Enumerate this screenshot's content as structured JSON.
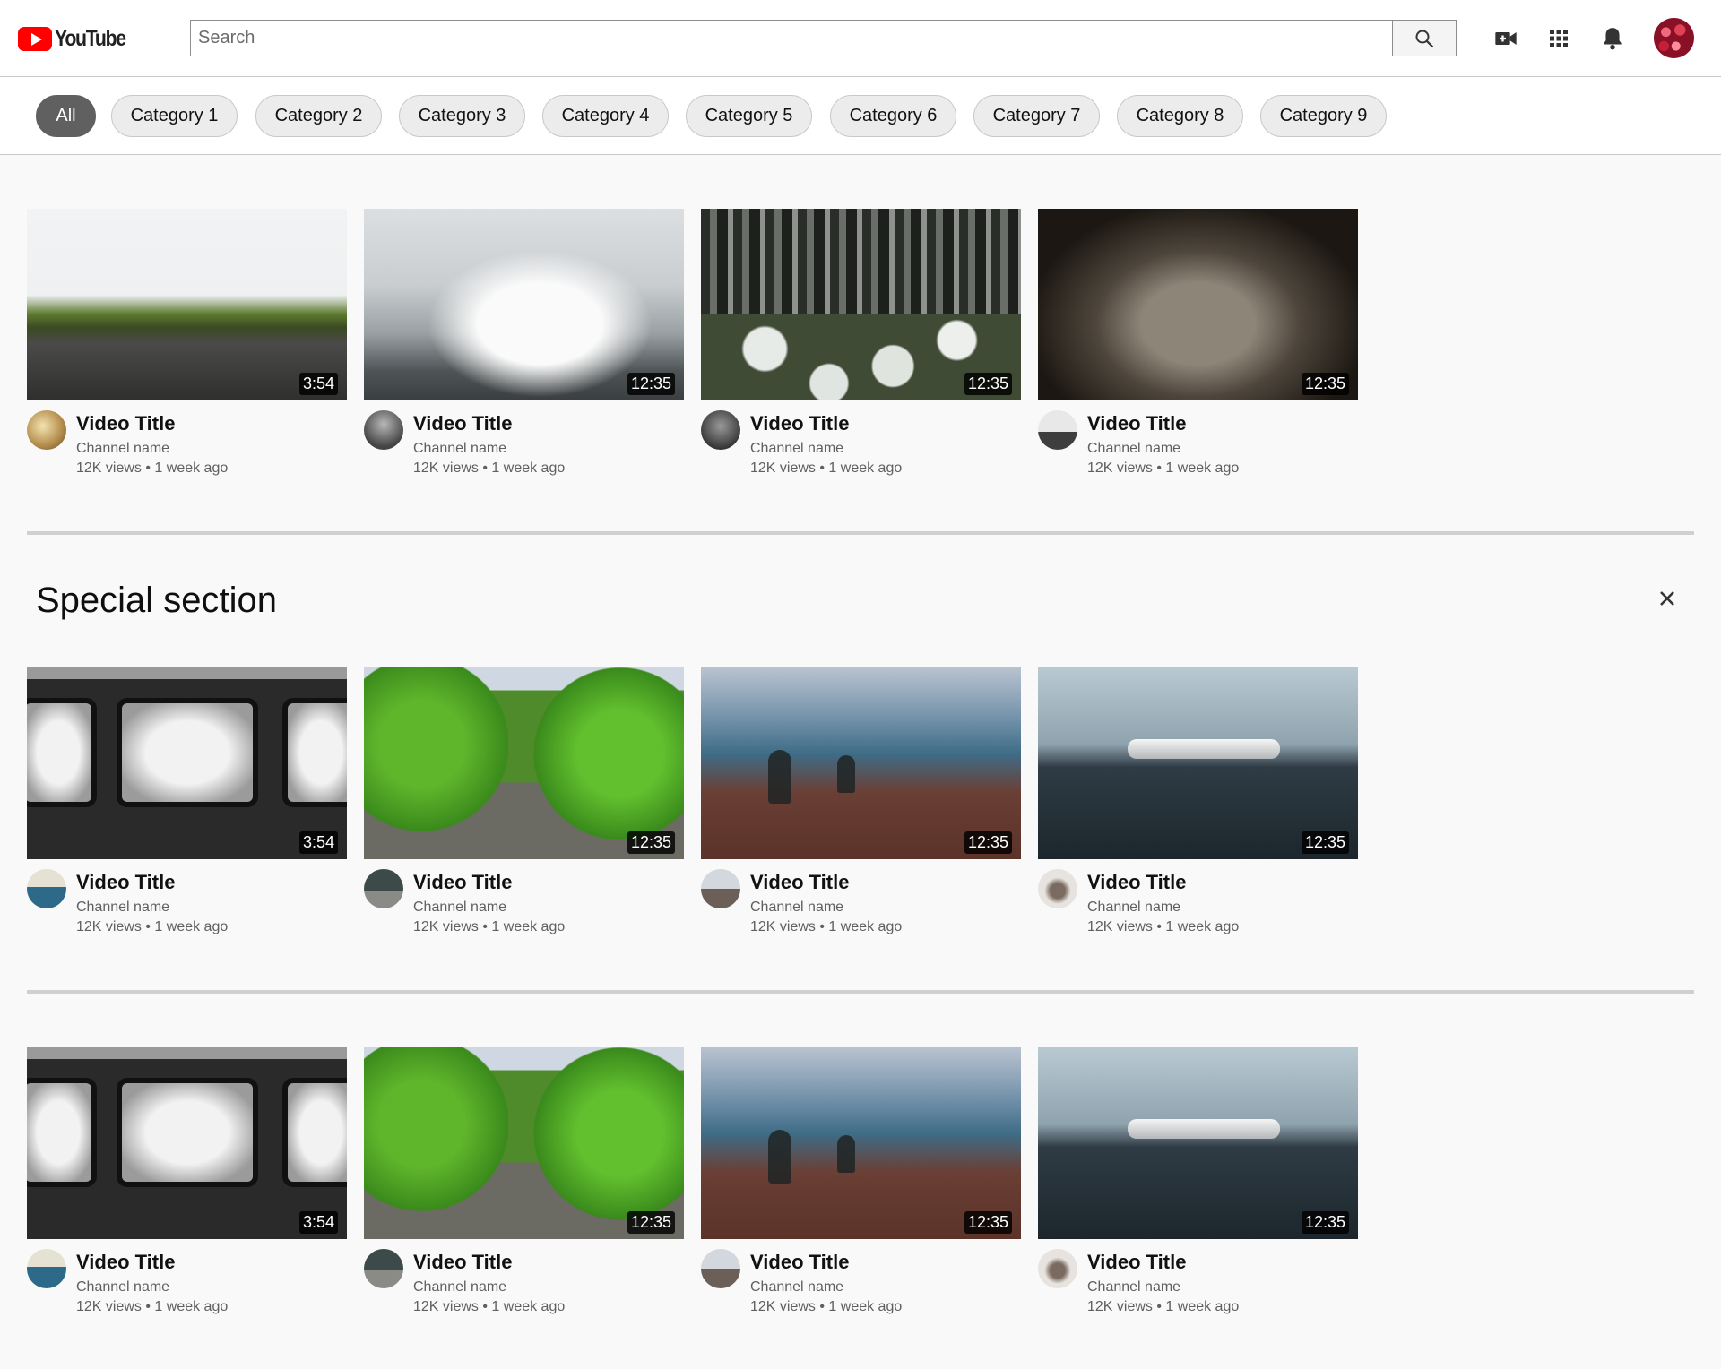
{
  "header": {
    "logo_text": "YouTube",
    "search_placeholder": "Search",
    "icons": [
      "search-icon",
      "video-camera-icon",
      "apps-grid-icon",
      "bell-icon"
    ]
  },
  "chips": [
    "All",
    "Category 1",
    "Category 2",
    "Category 3",
    "Category 4",
    "Category 5",
    "Category 6",
    "Category 7",
    "Category 8",
    "Category 9"
  ],
  "section": {
    "title": "Special section"
  },
  "rows": [
    [
      {
        "duration": "3:54",
        "title": "Video Title",
        "channel": "Channel name",
        "meta": "12K views • 1 week ago"
      },
      {
        "duration": "12:35",
        "title": "Video Title",
        "channel": "Channel name",
        "meta": "12K views • 1 week ago"
      },
      {
        "duration": "12:35",
        "title": "Video Title",
        "channel": "Channel name",
        "meta": "12K views • 1 week ago"
      },
      {
        "duration": "12:35",
        "title": "Video Title",
        "channel": "Channel name",
        "meta": "12K views • 1 week ago"
      }
    ],
    [
      {
        "duration": "3:54",
        "title": "Video Title",
        "channel": "Channel name",
        "meta": "12K views • 1 week ago"
      },
      {
        "duration": "12:35",
        "title": "Video Title",
        "channel": "Channel name",
        "meta": "12K views • 1 week ago"
      },
      {
        "duration": "12:35",
        "title": "Video Title",
        "channel": "Channel name",
        "meta": "12K views • 1 week ago"
      },
      {
        "duration": "12:35",
        "title": "Video Title",
        "channel": "Channel name",
        "meta": "12K views • 1 week ago"
      }
    ],
    [
      {
        "duration": "3:54",
        "title": "Video Title",
        "channel": "Channel name",
        "meta": "12K views • 1 week ago"
      },
      {
        "duration": "12:35",
        "title": "Video Title",
        "channel": "Channel name",
        "meta": "12K views • 1 week ago"
      },
      {
        "duration": "12:35",
        "title": "Video Title",
        "channel": "Channel name",
        "meta": "12K views • 1 week ago"
      },
      {
        "duration": "12:35",
        "title": "Video Title",
        "channel": "Channel name",
        "meta": "12K views • 1 week ago"
      }
    ]
  ]
}
